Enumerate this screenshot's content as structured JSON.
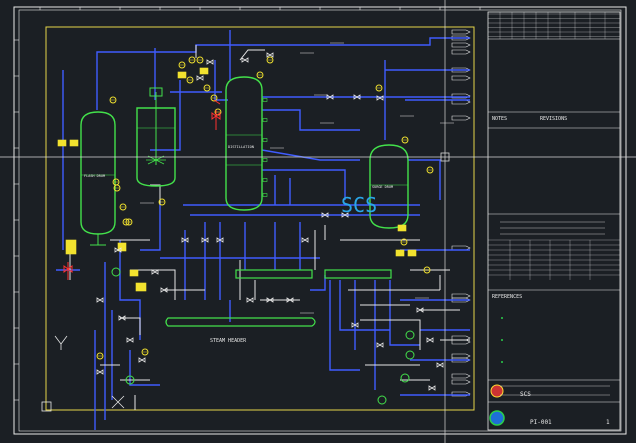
{
  "canvas": {
    "background": "#1b1f24",
    "colors": {
      "frame": "#e8e8e8",
      "border_yellow": "#e6d64a",
      "vessel_green": "#43e14b",
      "pipe_blue": "#3f5cff",
      "pipe_white": "#e6e6e6",
      "instrument_yellow": "#f2e22f",
      "valve_red": "#ff3030",
      "watermark_cyan": "#2aa6e8",
      "crosshair": "#d9d9d9"
    }
  },
  "drawing": {
    "watermark": "SCS",
    "distillation_column_tag": "DISTILLATION",
    "left_vessel_tag": "FLASH DRUM",
    "right_vessel_tag": "SURGE DRUM",
    "header_label": "STEAM HEADER",
    "ucs_icon_y": "Y",
    "ucs_icon_x": "X"
  },
  "title_block": {
    "section_notes": "NOTES",
    "section_revisions": "REVISIONS",
    "section_references": "REFERENCES",
    "company_line": "SCS",
    "drawing_number": "PI-001",
    "sheet": "1"
  }
}
